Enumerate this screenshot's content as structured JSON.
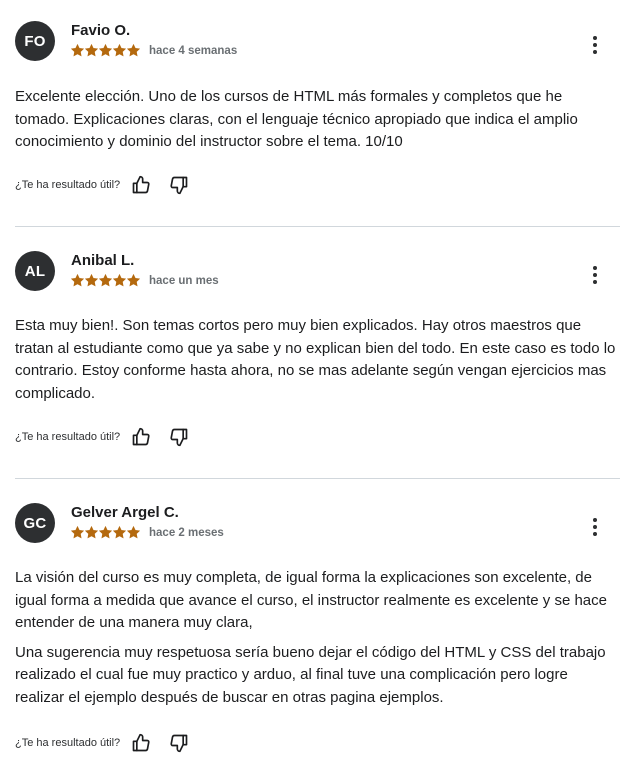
{
  "helpful_label": "¿Te ha resultado útil?",
  "colors": {
    "star": "#b4690e",
    "avatar_bg": "#2d2f31",
    "text": "#1c1d1f",
    "muted": "#6a6f73",
    "divider": "#d1d7dc"
  },
  "reviews": [
    {
      "initials": "FO",
      "author": "Favio O.",
      "rating": 5,
      "date": "hace 4 semanas",
      "paragraphs": [
        "Excelente elección. Uno de los cursos de HTML más formales y completos que he tomado. Explicaciones claras, con el lenguaje técnico apropiado que indica el amplio conocimiento y dominio del instructor sobre el tema. 10/10"
      ]
    },
    {
      "initials": "AL",
      "author": "Anibal L.",
      "rating": 5,
      "date": "hace un mes",
      "paragraphs": [
        "Esta muy bien!. Son temas cortos pero muy bien explicados. Hay otros maestros que tratan al estudiante como que ya sabe y no explican bien del todo. En este caso es todo lo contrario. Estoy conforme hasta ahora, no se mas adelante según vengan ejercicios mas complicado."
      ]
    },
    {
      "initials": "GC",
      "author": "Gelver Argel C.",
      "rating": 5,
      "date": "hace 2 meses",
      "paragraphs": [
        "La visión del curso es muy completa, de igual forma la explicaciones son excelente, de igual forma a medida que avance el curso, el instructor realmente es excelente y se hace entender de una manera muy clara,",
        "Una sugerencia muy respetuosa sería bueno dejar el código del HTML y CSS del trabajo realizado el cual fue muy practico y arduo, al final tuve una complicación pero logre realizar el ejemplo después de buscar en otras pagina ejemplos."
      ]
    }
  ]
}
